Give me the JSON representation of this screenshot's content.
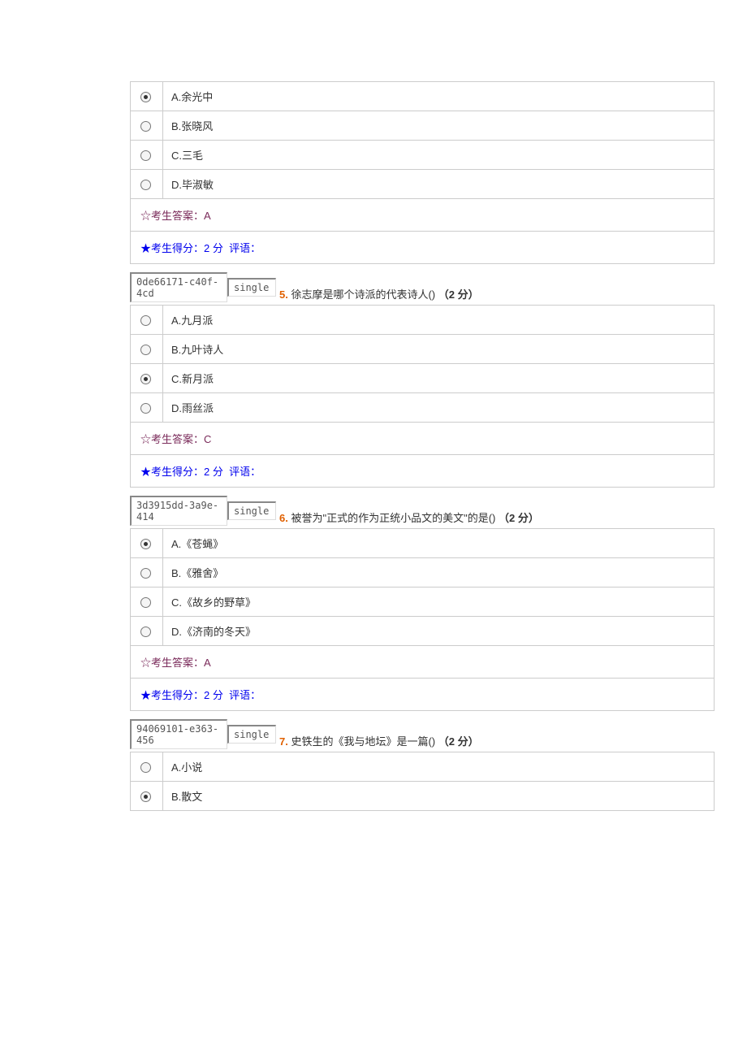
{
  "questions": [
    {
      "options": [
        {
          "letter": "A",
          "text": "余光中",
          "selected": true
        },
        {
          "letter": "B",
          "text": "张晓风",
          "selected": false
        },
        {
          "letter": "C",
          "text": "三毛",
          "selected": false
        },
        {
          "letter": "D",
          "text": "毕淑敏",
          "selected": false
        }
      ],
      "answer_label": "☆考生答案：",
      "answer_value": "A",
      "score_label": "★考生得分：",
      "score_value": "2 分",
      "comment_label": "评语："
    },
    {
      "meta_id": "0de66171-c40f-4cd",
      "meta_type": "single",
      "number": "5.",
      "title": "徐志摩是哪个诗派的代表诗人()",
      "points": "（2 分）",
      "options": [
        {
          "letter": "A",
          "text": "九月派",
          "selected": false
        },
        {
          "letter": "B",
          "text": "九叶诗人",
          "selected": false
        },
        {
          "letter": "C",
          "text": "新月派",
          "selected": true
        },
        {
          "letter": "D",
          "text": "雨丝派",
          "selected": false
        }
      ],
      "answer_label": "☆考生答案：",
      "answer_value": "C",
      "score_label": "★考生得分：",
      "score_value": "2 分",
      "comment_label": "评语："
    },
    {
      "meta_id": "3d3915dd-3a9e-414",
      "meta_type": "single",
      "number": "6.",
      "title": "被誉为\"正式的作为正统小品文的美文\"的是()",
      "points": "（2 分）",
      "options": [
        {
          "letter": "A",
          "text": "《苍蝇》",
          "selected": true
        },
        {
          "letter": "B",
          "text": "《雅舍》",
          "selected": false
        },
        {
          "letter": "C",
          "text": "《故乡的野草》",
          "selected": false
        },
        {
          "letter": "D",
          "text": "《济南的冬天》",
          "selected": false
        }
      ],
      "answer_label": "☆考生答案：",
      "answer_value": "A",
      "score_label": "★考生得分：",
      "score_value": "2 分",
      "comment_label": "评语："
    },
    {
      "meta_id": "94069101-e363-456",
      "meta_type": "single",
      "number": "7.",
      "title": "史铁生的《我与地坛》是一篇()",
      "points": "（2 分）",
      "options": [
        {
          "letter": "A",
          "text": "小说",
          "selected": false
        },
        {
          "letter": "B",
          "text": "散文",
          "selected": true
        }
      ]
    }
  ]
}
